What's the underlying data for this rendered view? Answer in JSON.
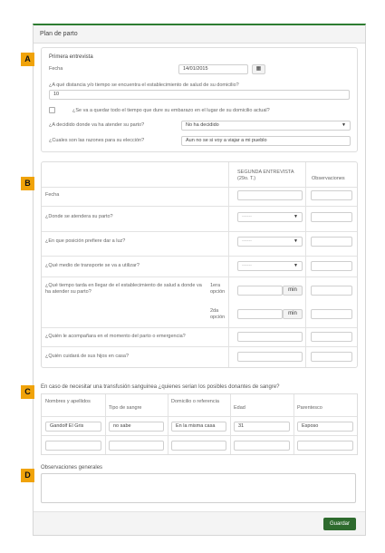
{
  "panel": {
    "title": "Plan de parto"
  },
  "badges": {
    "a": "A",
    "b": "B",
    "c": "C",
    "d": "D"
  },
  "section_a": {
    "heading": "Primera entrevista",
    "fecha_label": "Fecha",
    "fecha_value": "14/01/2015",
    "calendar_icon": "calendar-icon",
    "distancia_label": "¿A qué distancia y/o tiempo se encuentra el establecimiento de salud de su domicilio?",
    "distancia_value": "10",
    "quedar_label": "¿Se va a quedar todo el tiempo que dure su embarazo en el lugar de su domicilio actual?",
    "atender_label": "¿A decidido donde va ha atender su parto?",
    "atender_value": "No ha decidido",
    "razones_label": "¿Cuales son las razones para su elección?",
    "razones_value": "Aun no se si voy a viajar a mi pueblo"
  },
  "section_b": {
    "col_segunda": "SEGUNDA ENTREVISTA (29o. T.)",
    "col_obs": "Observaciones",
    "rows": {
      "fecha": "Fecha",
      "donde": "¿Donde se atendera su parto?",
      "posicion": "¿En que posición prefiere dar a luz?",
      "transporte": "¿Qué medio de transporte se va a utilizar?",
      "tiempo": "¿Qué tiempo tarda en llegar de el establecimiento de salud a donde va ha atender su parto?",
      "opcion1": "1era opción",
      "opcion2": "2da opción",
      "acompanara": "¿Quién le acompañara en el momento del parto o emergencia?",
      "cuidara": "¿Quién cuidará de sus hijos en casa?"
    },
    "select_placeholder": "------",
    "min_label": "min"
  },
  "section_c": {
    "question": "En caso de necesitar una transfusión sanguinea ¿quienes serian los posibles donantes de sangre?",
    "headers": [
      "Nombres y apellidos",
      "Tipo de sangre",
      "Domicilio o referencia",
      "Edad",
      "Parentesco"
    ],
    "row1": [
      "Gandolf El Gris",
      "no sabe",
      "En la misma casa",
      "31",
      "Esposo"
    ]
  },
  "section_d": {
    "label": "Observaciones generales"
  },
  "footer": {
    "save_label": "Guardar"
  }
}
